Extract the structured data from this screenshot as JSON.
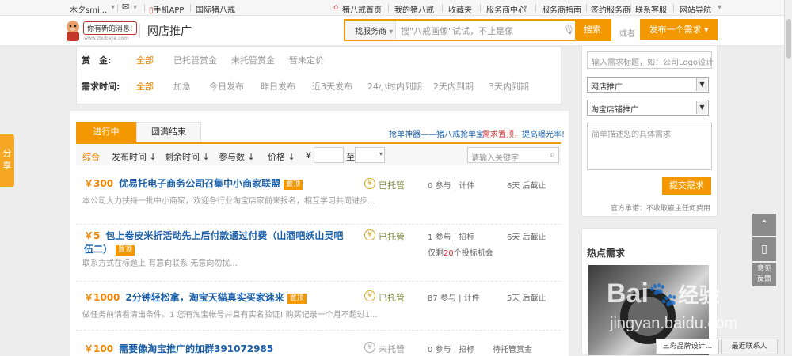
{
  "topbar": {
    "user": "木夕smi...",
    "msg_icon": "mail-icon",
    "msg_tooltip": "你有新的消息!",
    "phone_app": "手机APP",
    "intl": "国际猪八戒",
    "home": "猪八戒首页",
    "my": "我的猪八戒",
    "fav": "收藏夹",
    "sp_center": "服务商中心",
    "sp_guide": "服务商指南",
    "sign_sp": "签约服务商",
    "contact": "联系客服",
    "site_nav": "网站导航"
  },
  "header": {
    "logo_sub": "www.zhubajie.com",
    "page_title": "网店推广",
    "search_scope": "找服务商",
    "search_placeholder": "搜\"八戒画像\"试试，不止是像",
    "search_btn": "搜索",
    "or": "或者",
    "publish_btn": "发布一个需求"
  },
  "filters": {
    "reward_label": "赏　金:",
    "reward_opts": [
      "全部",
      "已托管赏金",
      "未托管赏金",
      "暂未定价"
    ],
    "time_label": "需求时间:",
    "time_opts": [
      "全部",
      "加急",
      "今日发布",
      "昨日发布",
      "近3天发布",
      "24小时内到期",
      "2天内到期",
      "3天内到期"
    ]
  },
  "tabs": {
    "active": "进行中",
    "other": "圆满结束",
    "promo1": "抢单神器——猪八戒抢单宝",
    "promo2a": "需求置顶，",
    "promo2b": "提高曝光率!"
  },
  "sortbar": {
    "items": [
      "综合",
      "发布时间",
      "剩余时间",
      "参与数",
      "价格"
    ],
    "yen": "¥",
    "to": "至",
    "keyword_placeholder": "请输入关键字"
  },
  "tasks": [
    {
      "price": "￥300",
      "title": "优易托电子商务公司召集中小商家联盟",
      "badge": "置顶",
      "desc": "本公司大力扶持一批中小商家，欢迎各行业淘宝店家前来报名，相互学习共同进步...",
      "status": "已托管",
      "count": "0 参与",
      "mode": "计件",
      "deadline": "6天 后截止"
    },
    {
      "price": "￥5",
      "title": "包上卷皮米折活动先上后付款通过付费（山酒吧妖山灵吧伍二）",
      "badge": "置顶",
      "desc": "联系方式在标题上 有意向联系 无意向勿扰...",
      "status": "已托管",
      "count": "1 参与",
      "mode": "招标",
      "extra_pre": "仅剩",
      "extra_num": "20",
      "extra_post": "个投标机会",
      "deadline": "6天 后截止"
    },
    {
      "price": "￥1000",
      "title": "2分钟轻松拿，淘宝天猫真实买家速来",
      "badge": "置顶",
      "desc": "做任务前请看清出条件。1 您有淘宝帐号并且有实名验证! 购买记录一个月不超过1...",
      "status": "已托管",
      "count": "87 参与",
      "mode": "计件",
      "deadline": "5天 后截止"
    },
    {
      "price": "￥100",
      "title": "需要像淘宝推广的加群391072985",
      "status": "未托管",
      "count": "0 参与",
      "mode": "招标",
      "deadline": "待托管赏金"
    }
  ],
  "sidebar": {
    "title_placeholder": "输入需求标题，如：公司Logo设计",
    "cat1": "网店推广",
    "cat2": "淘宝店铺推广",
    "desc_placeholder": "简单描述您的具体需求",
    "submit": "提交需求",
    "promise": "官方承诺：不收取雇主任何费用",
    "hot_title": "热点需求",
    "hot_item": "三彩品牌设计...",
    "recent": "最近联系人"
  },
  "share": "分享",
  "tools": {
    "up": "chevron-up-icon",
    "phone": "phone-icon",
    "feedback": "意见反馈"
  },
  "watermark": {
    "brand": "Bai",
    "brand2": "经验",
    "url": "jingyan.baidu.com"
  }
}
